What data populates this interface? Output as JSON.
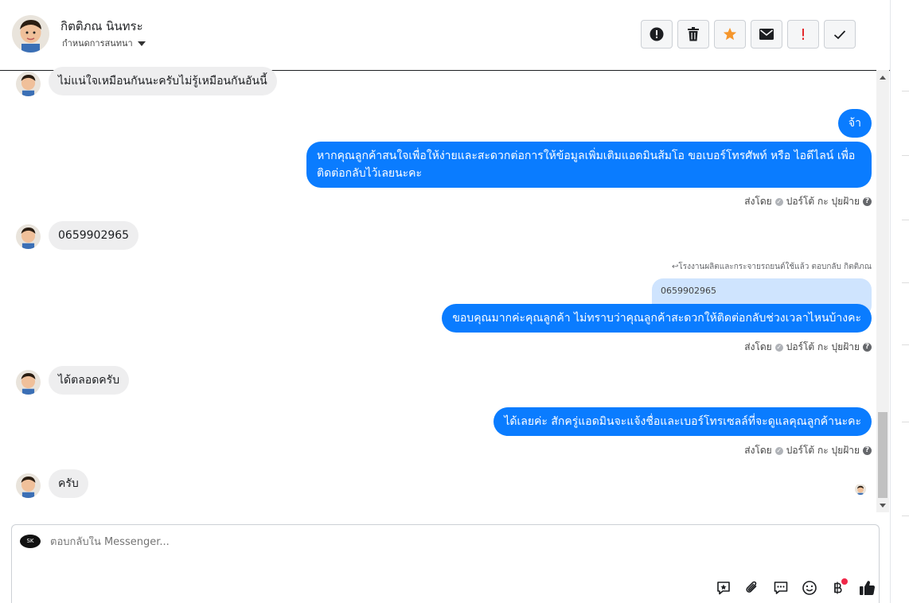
{
  "header": {
    "contact_name": "กิตติภณ นินทระ",
    "subtitle": "กำหนดการสนทนา",
    "actions": [
      {
        "name": "alert-icon"
      },
      {
        "name": "trash-icon"
      },
      {
        "name": "star-icon",
        "color": "#f5962c"
      },
      {
        "name": "mail-icon"
      },
      {
        "name": "exclamation-icon",
        "color": "#e4282c"
      },
      {
        "name": "check-icon"
      }
    ]
  },
  "messages": [
    {
      "direction": "in",
      "text": "ไม่แน่ใจเหมือนกันนะครับไม่รู้เหมือนกันอันนี้"
    },
    {
      "direction": "out",
      "text": "จ้า"
    },
    {
      "direction": "out",
      "text": "หากคุณลูกค้าสนใจเพื่อให้ง่ายและสะดวกต่อการให้ข้อมูลเพิ่มเติมแอดมินส้มโอ ขอเบอร์โทรศัพท์ หรือ ไอดีไลน์ เพื่อติดต่อกลับไว้เลยนะคะ",
      "sent_by": "ส่งโดย",
      "sender": "ปอร์โต้ กะ ปุยฝ้าย"
    },
    {
      "direction": "in",
      "text": "0659902965"
    },
    {
      "direction": "out",
      "reply_note": "โรงงานผลิตและกระจายรถยนต์ใช้แล้ว ตอบกลับ กิตติภณ",
      "quoted": "0659902965",
      "text": "ขอบคุณมากค่ะคุณลูกค้า ไม่ทราบว่าคุณลูกค้าสะดวกให้ติดต่อกลับช่วงเวลาไหนบ้างคะ",
      "sent_by": "ส่งโดย",
      "sender": "ปอร์โต้ กะ ปุยฝ้าย"
    },
    {
      "direction": "in",
      "text": "ได้ตลอดครับ"
    },
    {
      "direction": "out",
      "text": "ได้เลยค่ะ สักครู่แอดมินจะแจ้งชื่อและเบอร์โทรเซลล์ที่จะดูแลคุณลูกค้านะคะ",
      "sent_by": "ส่งโดย",
      "sender": "ปอร์โต้ กะ ปุยฝ้าย"
    },
    {
      "direction": "in",
      "text": "ครับ"
    }
  ],
  "composer": {
    "placeholder": "ตอบกลับใน Messenger...",
    "page_logo_text": "SK",
    "tools": [
      "saved-reply-icon",
      "attachment-icon",
      "chat-bubble-icon",
      "emoji-icon",
      "baht-payment-icon",
      "like-icon"
    ]
  },
  "colors": {
    "outgoing_bubble": "#0a7cff",
    "incoming_bubble": "#eeeeef",
    "quoted_bubble": "#cfe4fe"
  }
}
